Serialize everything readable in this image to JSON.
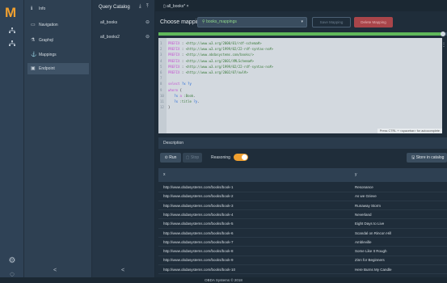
{
  "rail": {
    "logo": "M",
    "icons": [
      "diagram-icon",
      "hierarchy-icon",
      "settings-icon",
      "help-icon"
    ]
  },
  "nav": {
    "items": [
      {
        "label": "Info",
        "icon": "info-icon"
      },
      {
        "label": "Navigation",
        "icon": "file-icon"
      },
      {
        "label": "Graphql",
        "icon": "graph-icon"
      },
      {
        "label": "Mappings",
        "icon": "anchor-icon"
      },
      {
        "label": "Endpoint",
        "icon": "endpoint-icon"
      }
    ],
    "active_index": 4,
    "collapse": "<"
  },
  "catalog": {
    "title": "Query Catalog",
    "queries": [
      {
        "label": "all_books"
      },
      {
        "label": "all_books2"
      }
    ],
    "collapse": "<"
  },
  "tabs": [
    {
      "label": "all_books*",
      "close": "×"
    }
  ],
  "mapping": {
    "label": "Choose mapping:",
    "selected": "books_mappings",
    "save_label": "Save Mapping",
    "delete_label": "Delete Mapping"
  },
  "progress": 0.99,
  "editor": {
    "lines": [
      {
        "n": "1",
        "parts": [
          [
            "kw",
            "PREFIX "
          ],
          [
            "plain",
            ": "
          ],
          [
            "iri",
            "<http://www.w3.org/2000/01/rdf-schema#>"
          ]
        ]
      },
      {
        "n": "2",
        "parts": [
          [
            "kw",
            "PREFIX "
          ],
          [
            "plain",
            ": "
          ],
          [
            "iri",
            "<http://www.w3.org/1999/02/22-rdf-syntax-ns#>"
          ]
        ]
      },
      {
        "n": "3",
        "parts": [
          [
            "kw",
            "PREFIX "
          ],
          [
            "plain",
            ": "
          ],
          [
            "iri",
            "<http://www.obdasystems.com/books/>"
          ]
        ]
      },
      {
        "n": "4",
        "parts": [
          [
            "kw",
            "PREFIX "
          ],
          [
            "plain",
            ": "
          ],
          [
            "iri",
            "<http://www.w3.org/2001/XMLSchema#>"
          ]
        ]
      },
      {
        "n": "5",
        "parts": [
          [
            "kw",
            "PREFIX "
          ],
          [
            "plain",
            ": "
          ],
          [
            "iri",
            "<http://www.w3.org/1999/02/22-rdf-syntax-ns#>"
          ]
        ]
      },
      {
        "n": "6",
        "parts": [
          [
            "kw",
            "PREFIX "
          ],
          [
            "plain",
            ": "
          ],
          [
            "iri",
            "<http://www.w3.org/2002/07/owl#>"
          ]
        ]
      },
      {
        "n": "7",
        "parts": []
      },
      {
        "n": "8",
        "parts": [
          [
            "kw",
            "select "
          ],
          [
            "var",
            "?x ?y"
          ]
        ]
      },
      {
        "n": "9",
        "parts": [
          [
            "kw",
            "where "
          ],
          [
            "plain",
            "{"
          ]
        ]
      },
      {
        "n": "10",
        "parts": [
          [
            "plain",
            "   "
          ],
          [
            "var",
            "?x "
          ],
          [
            "kw",
            "a "
          ],
          [
            "iri",
            ":Book"
          ],
          [
            "plain",
            "."
          ]
        ]
      },
      {
        "n": "11",
        "parts": [
          [
            "plain",
            "   "
          ],
          [
            "var",
            "?x "
          ],
          [
            "iri",
            ":title "
          ],
          [
            "var",
            "?y"
          ],
          [
            "plain",
            "."
          ]
        ]
      },
      {
        "n": "12",
        "parts": [
          [
            "plain",
            "}"
          ]
        ]
      }
    ],
    "hint": "Press CTRL + <spacebar> for autocomplete"
  },
  "description_label": "Description",
  "actions": {
    "run": "Run",
    "stop": "Stop",
    "reasoning": "Reasoning",
    "reasoning_on": true,
    "store": "Store in catalog"
  },
  "table": {
    "columns": [
      "x",
      "y"
    ],
    "rows": [
      [
        "http://www.obdasystems.com/books/book-1",
        "Resonance"
      ],
      [
        "http://www.obdasystems.com/books/book-2",
        "As we Grieve"
      ],
      [
        "http://www.obdasystems.com/books/book-3",
        "Runaway Storm"
      ],
      [
        "http://www.obdasystems.com/books/book-4",
        "Neverland"
      ],
      [
        "http://www.obdasystems.com/books/book-5",
        "Eight Days to Live"
      ],
      [
        "http://www.obdasystems.com/books/book-6",
        "Scandal on Rincon Hill"
      ],
      [
        "http://www.obdasystems.com/books/book-7",
        "Ambleville"
      ],
      [
        "http://www.obdasystems.com/books/book-8",
        "Some Like It Rough"
      ],
      [
        "http://www.obdasystems.com/books/book-9",
        "Zinn for Beginners"
      ],
      [
        "http://www.obdasystems.com/books/book-10",
        "Here Burns My Candle"
      ]
    ]
  },
  "footer": "OBDA Systems © 2018"
}
